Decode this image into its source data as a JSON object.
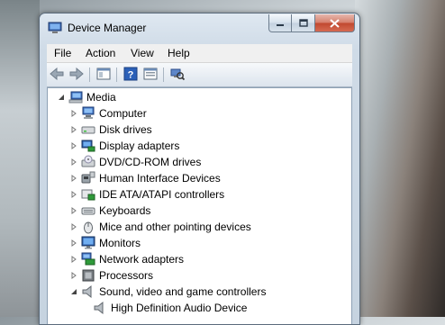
{
  "window": {
    "title": "Device Manager",
    "caption_buttons": [
      "minimize-button",
      "maximize-button",
      "close-button"
    ]
  },
  "menu": [
    "File",
    "Action",
    "View",
    "Help"
  ],
  "toolbar": {
    "buttons": [
      "back-icon",
      "forward-icon",
      "show-hide-console-tree-icon",
      "help-icon",
      "properties-icon",
      "scan-hardware-icon"
    ]
  },
  "tree": {
    "root": {
      "label": "Media",
      "icon": "computer-root-icon",
      "expanded": true
    },
    "items": [
      {
        "label": "Computer",
        "icon": "computer-icon",
        "expanded": false
      },
      {
        "label": "Disk drives",
        "icon": "disk-drive-icon",
        "expanded": false
      },
      {
        "label": "Display adapters",
        "icon": "display-adapter-icon",
        "expanded": false
      },
      {
        "label": "DVD/CD-ROM drives",
        "icon": "dvd-drive-icon",
        "expanded": false
      },
      {
        "label": "Human Interface Devices",
        "icon": "hid-icon",
        "expanded": false
      },
      {
        "label": "IDE ATA/ATAPI controllers",
        "icon": "ide-controller-icon",
        "expanded": false
      },
      {
        "label": "Keyboards",
        "icon": "keyboard-icon",
        "expanded": false
      },
      {
        "label": "Mice and other pointing devices",
        "icon": "mouse-icon",
        "expanded": false
      },
      {
        "label": "Monitors",
        "icon": "monitor-icon",
        "expanded": false
      },
      {
        "label": "Network adapters",
        "icon": "network-adapter-icon",
        "expanded": false
      },
      {
        "label": "Processors",
        "icon": "processor-icon",
        "expanded": false
      },
      {
        "label": "Sound, video and game controllers",
        "icon": "speaker-icon",
        "expanded": true
      }
    ],
    "children": [
      {
        "label": "High Definition Audio Device",
        "icon": "speaker-icon"
      }
    ]
  }
}
